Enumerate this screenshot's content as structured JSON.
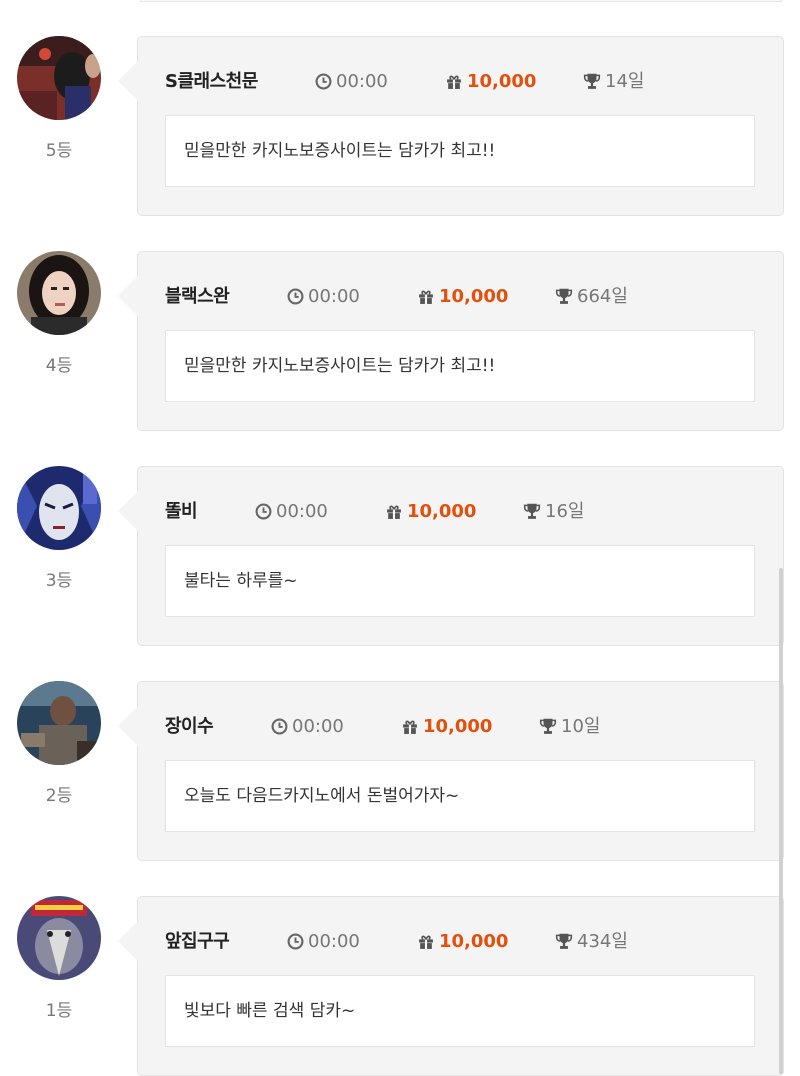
{
  "entries": [
    {
      "rank": "5등",
      "nickname": "S클래스천문",
      "time": "00:00",
      "points": "10,000",
      "days": "14일",
      "message": "믿을만한 카지노보증사이트는 담카가 최고!!",
      "avatar_icon": "user-avatar-photo"
    },
    {
      "rank": "4등",
      "nickname": "블랙스완",
      "time": "00:00",
      "points": "10,000",
      "days": "664일",
      "message": "믿을만한 카지노보증사이트는 담카가 최고!!",
      "avatar_icon": "user-avatar-photo"
    },
    {
      "rank": "3등",
      "nickname": "똘비",
      "time": "00:00",
      "points": "10,000",
      "days": "16일",
      "message": "불타는 하루를~",
      "avatar_icon": "user-avatar-photo"
    },
    {
      "rank": "2등",
      "nickname": "장이수",
      "time": "00:00",
      "points": "10,000",
      "days": "10일",
      "message": "오늘도 다음드카지노에서 돈벌어가자~",
      "avatar_icon": "user-avatar-photo"
    },
    {
      "rank": "1등",
      "nickname": "앞집구구",
      "time": "00:00",
      "points": "10,000",
      "days": "434일",
      "message": "빛보다 빠른 검색 담카~",
      "avatar_icon": "user-avatar-photo"
    }
  ],
  "icons": {
    "time": "clock-icon",
    "points": "gift-icon",
    "days": "trophy-icon"
  },
  "colors": {
    "points": "#e2500e",
    "card_bg": "#f4f4f4",
    "message_bg": "#ffffff"
  }
}
